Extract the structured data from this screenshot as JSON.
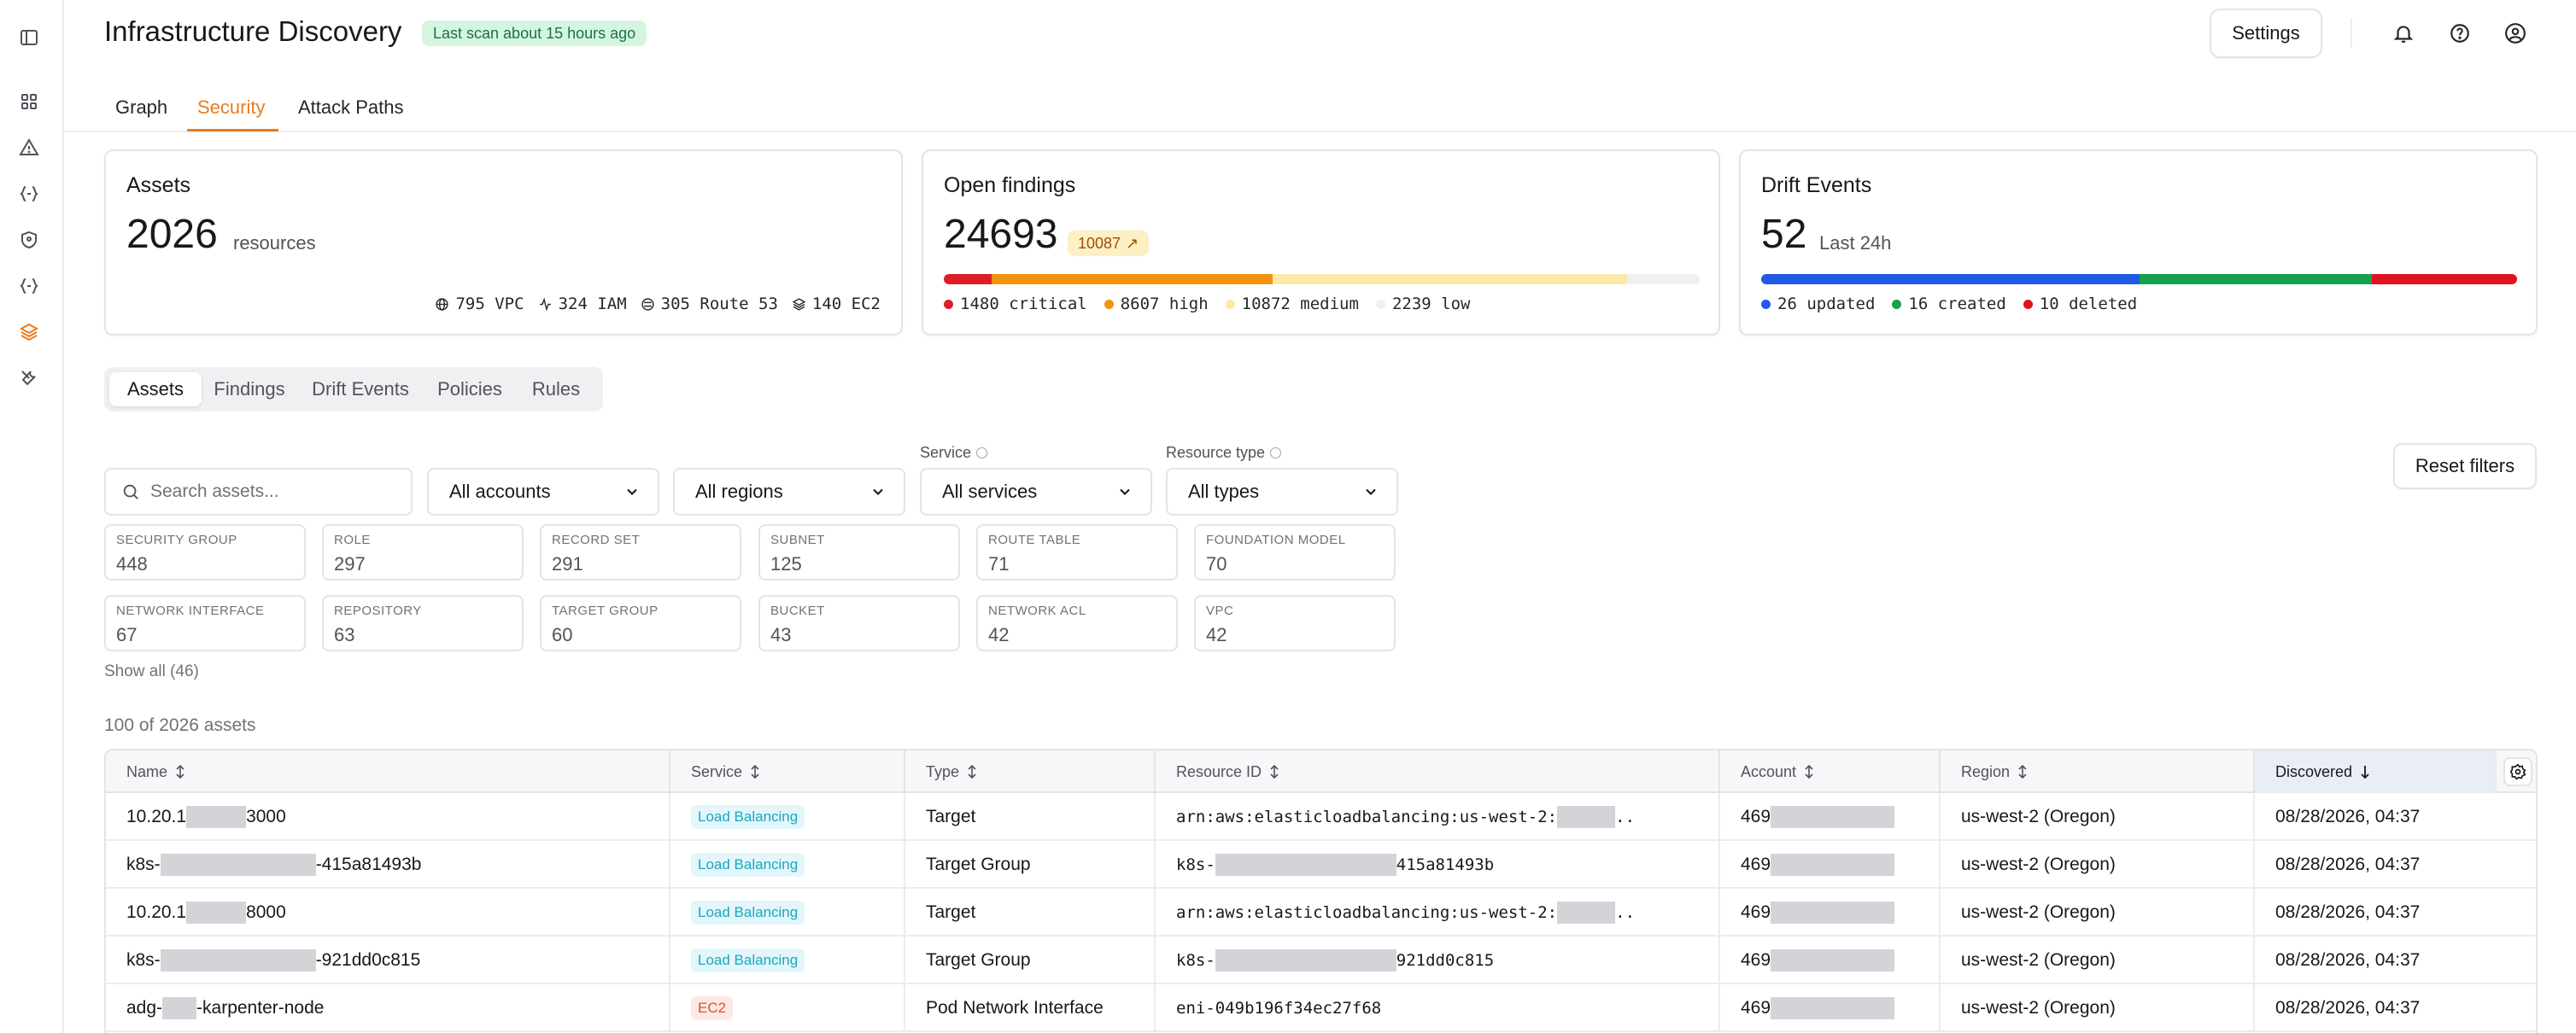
{
  "header": {
    "title": "Infrastructure Discovery",
    "scan_status": "Last scan about 15 hours ago",
    "settings_label": "Settings"
  },
  "sidebar": {
    "items": [
      {
        "icon": "sidebar-toggle-icon"
      },
      {
        "icon": "dashboard-icon"
      },
      {
        "icon": "alert-triangle-icon"
      },
      {
        "icon": "code-braces-icon"
      },
      {
        "icon": "shield-icon"
      },
      {
        "icon": "code-braces-icon"
      },
      {
        "icon": "layers-icon",
        "active": true
      },
      {
        "icon": "tools-icon"
      }
    ]
  },
  "tabs": [
    {
      "label": "Graph",
      "active": false
    },
    {
      "label": "Security",
      "active": true
    },
    {
      "label": "Attack Paths",
      "active": false
    }
  ],
  "cards": {
    "assets": {
      "title": "Assets",
      "count": "2026",
      "unit": "resources",
      "stats": [
        {
          "icon": "globe-icon",
          "label": "795 VPC"
        },
        {
          "icon": "activity-icon",
          "label": "324 IAM"
        },
        {
          "icon": "route-icon",
          "label": "305 Route 53"
        },
        {
          "icon": "layers-icon",
          "label": "140 EC2"
        }
      ]
    },
    "findings": {
      "title": "Open findings",
      "count": "24693",
      "badge": "10087",
      "segments": [
        {
          "label": "1480 critical",
          "value": 1480,
          "color": "#dc1f26"
        },
        {
          "label": "8607 high",
          "value": 8607,
          "color": "#f2930d"
        },
        {
          "label": "10872 medium",
          "value": 10872,
          "color": "#fde8a8"
        },
        {
          "label": "2239 low",
          "value": 2239,
          "color": "#f0f0f3"
        }
      ]
    },
    "drift": {
      "title": "Drift Events",
      "count": "52",
      "unit": "Last 24h",
      "segments": [
        {
          "label": "26 updated",
          "value": 26,
          "color": "#1f5ae8"
        },
        {
          "label": "16 created",
          "value": 16,
          "color": "#18a04a"
        },
        {
          "label": "10 deleted",
          "value": 10,
          "color": "#e0141e"
        }
      ]
    }
  },
  "subtabs": [
    {
      "label": "Assets",
      "active": true
    },
    {
      "label": "Findings",
      "active": false
    },
    {
      "label": "Drift Events",
      "active": false
    },
    {
      "label": "Policies",
      "active": false
    },
    {
      "label": "Rules",
      "active": false
    }
  ],
  "filters": {
    "search_placeholder": "Search assets...",
    "accounts": "All accounts",
    "regions": "All regions",
    "service_label": "Service",
    "services": "All services",
    "type_label": "Resource type",
    "types": "All types",
    "reset_label": "Reset filters"
  },
  "type_tiles": [
    {
      "label": "Security Group",
      "count": "448"
    },
    {
      "label": "Role",
      "count": "297"
    },
    {
      "label": "Record Set",
      "count": "291"
    },
    {
      "label": "Subnet",
      "count": "125"
    },
    {
      "label": "Route Table",
      "count": "71"
    },
    {
      "label": "Foundation Model",
      "count": "70"
    },
    {
      "label": "Network Interface",
      "count": "67"
    },
    {
      "label": "Repository",
      "count": "63"
    },
    {
      "label": "Target Group",
      "count": "60"
    },
    {
      "label": "Bucket",
      "count": "43"
    },
    {
      "label": "Network ACL",
      "count": "42"
    },
    {
      "label": "VPC",
      "count": "42"
    }
  ],
  "show_all": "Show all (46)",
  "asset_count": "100 of 2026 assets",
  "table": {
    "columns": [
      "Name",
      "Service",
      "Type",
      "Resource ID",
      "Account",
      "Region",
      "Discovered"
    ],
    "rows": [
      {
        "name_pre": "10.20.1",
        "name_post": "3000",
        "service": "Load Balancing",
        "service_color": "#18a7c4",
        "service_bg": "#e3f7fb",
        "type": "Target",
        "rid_pre": "arn:aws:elasticloadbalancing:us-west-2:",
        "rid_post": "..",
        "account": "469",
        "region": "us-west-2 (Oregon)",
        "discovered": "08/28/2026, 04:37"
      },
      {
        "name_pre": "k8s-",
        "name_post": "-415a81493b",
        "service": "Load Balancing",
        "service_color": "#18a7c4",
        "service_bg": "#e3f7fb",
        "type": "Target Group",
        "rid_pre": "k8s-",
        "rid_post": "415a81493b",
        "account": "469",
        "region": "us-west-2 (Oregon)",
        "discovered": "08/28/2026, 04:37"
      },
      {
        "name_pre": "10.20.1",
        "name_post": "8000",
        "service": "Load Balancing",
        "service_color": "#18a7c4",
        "service_bg": "#e3f7fb",
        "type": "Target",
        "rid_pre": "arn:aws:elasticloadbalancing:us-west-2:",
        "rid_post": "..",
        "account": "469",
        "region": "us-west-2 (Oregon)",
        "discovered": "08/28/2026, 04:37"
      },
      {
        "name_pre": "k8s-",
        "name_post": "-921dd0c815",
        "service": "Load Balancing",
        "service_color": "#18a7c4",
        "service_bg": "#e3f7fb",
        "type": "Target Group",
        "rid_pre": "k8s-",
        "rid_post": "921dd0c815",
        "account": "469",
        "region": "us-west-2 (Oregon)",
        "discovered": "08/28/2026, 04:37"
      },
      {
        "name_pre": "adg-",
        "name_post": "-karpenter-node",
        "service": "EC2",
        "service_color": "#e0512a",
        "service_bg": "#fde9e4",
        "type": "Pod Network Interface",
        "rid_pre": "eni-049b196f34ec27f68",
        "rid_post": "",
        "account": "469",
        "region": "us-west-2 (Oregon)",
        "discovered": "08/28/2026, 04:37"
      }
    ]
  }
}
